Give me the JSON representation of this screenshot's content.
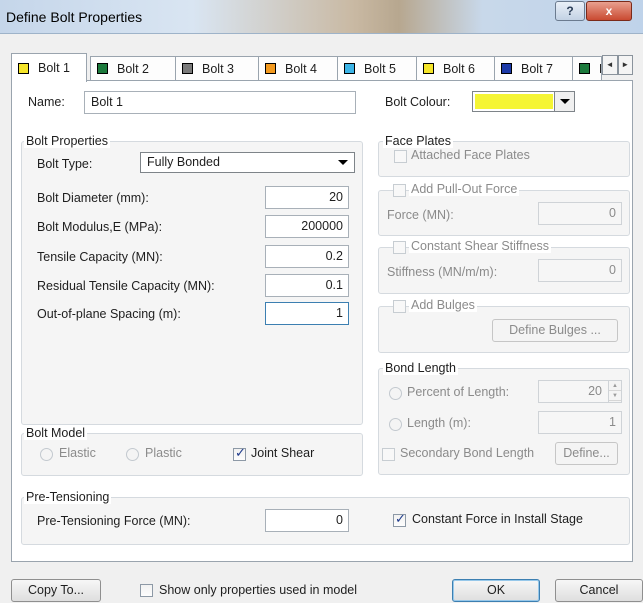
{
  "window": {
    "title": "Define Bolt Properties",
    "help_label": "?",
    "close_label": "x"
  },
  "tabs": [
    {
      "label": "Bolt 1",
      "color": "#f5e52a"
    },
    {
      "label": "Bolt 2",
      "color": "#1c7a3c"
    },
    {
      "label": "Bolt 3",
      "color": "#7a7a7a"
    },
    {
      "label": "Bolt 4",
      "color": "#f39a1f"
    },
    {
      "label": "Bolt 5",
      "color": "#3cb4e6"
    },
    {
      "label": "Bolt 6",
      "color": "#f5e52a"
    },
    {
      "label": "Bolt 7",
      "color": "#1c3aa8"
    },
    {
      "label": "B",
      "color": "#1c7a3c"
    }
  ],
  "tab_scroll": {
    "left": "◄",
    "right": "►"
  },
  "name": {
    "label": "Name:",
    "value": "Bolt 1"
  },
  "bolt_colour": {
    "label": "Bolt Colour:",
    "value": "#f5f534"
  },
  "bolt_properties": {
    "title": "Bolt Properties",
    "type_label": "Bolt Type:",
    "type_value": "Fully Bonded",
    "fields": [
      {
        "label": "Bolt Diameter (mm):",
        "value": "20"
      },
      {
        "label": "Bolt Modulus,E (MPa):",
        "value": "200000"
      },
      {
        "label": "Tensile Capacity (MN):",
        "value": "0.2"
      },
      {
        "label": "Residual Tensile Capacity (MN):",
        "value": "0.1"
      },
      {
        "label": "Out-of-plane Spacing (m):",
        "value": "1"
      }
    ]
  },
  "bolt_model": {
    "title": "Bolt Model",
    "elastic": "Elastic",
    "plastic": "Plastic",
    "joint_shear": "Joint Shear"
  },
  "face_plates": {
    "title": "Face Plates",
    "attached": "Attached Face Plates"
  },
  "pull_out": {
    "checkbox": "Add Pull-Out Force",
    "label": "Force (MN):",
    "value": "0"
  },
  "shear_stiffness": {
    "checkbox": "Constant Shear Stiffness",
    "label": "Stiffness (MN/m/m):",
    "value": "0"
  },
  "bulges": {
    "checkbox": "Add Bulges",
    "button": "Define Bulges ..."
  },
  "bond_length": {
    "title": "Bond Length",
    "percent_label": "Percent of Length:",
    "percent_value": "20",
    "length_label": "Length (m):",
    "length_value": "1",
    "secondary_label": "Secondary Bond Length",
    "define_button": "Define..."
  },
  "pre_tensioning": {
    "title": "Pre-Tensioning",
    "force_label": "Pre-Tensioning Force (MN):",
    "force_value": "0",
    "constant_force": "Constant Force in Install Stage"
  },
  "footer": {
    "copy_to": "Copy To...",
    "show_only": "Show only properties used in model",
    "ok": "OK",
    "cancel": "Cancel"
  }
}
